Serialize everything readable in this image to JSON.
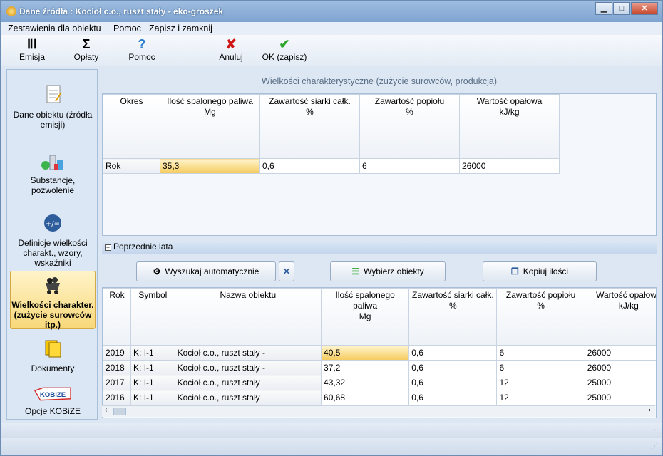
{
  "window": {
    "title": "Dane źródła : Kocioł c.o., ruszt stały - eko-groszek"
  },
  "menu": [
    "Zestawienia dla obiektu",
    "Pomoc",
    "Zapisz i zamknij"
  ],
  "toolbar": {
    "emisja": "Emisja",
    "oplaty": "Opłaty",
    "pomoc": "Pomoc",
    "anuluj": "Anuluj",
    "ok": "OK (zapisz)"
  },
  "sidebar": {
    "items": [
      {
        "label": "Dane obiektu (źródła emisji)"
      },
      {
        "label": "Substancje, pozwolenie"
      },
      {
        "label": "Definicje wielkości charakt., wzory, wskaźniki"
      },
      {
        "label": "Wielkości charakter. (zużycie surowców itp.)"
      },
      {
        "label": "Dokumenty"
      },
      {
        "label": "Opcje KOBiZE"
      }
    ]
  },
  "main": {
    "title": "Wielkości charakterystyczne (zużycie surowców, produkcja)",
    "top_grid": {
      "headers": [
        {
          "name": "Okres",
          "unit": ""
        },
        {
          "name": "Ilość spalonego paliwa",
          "unit": "Mg"
        },
        {
          "name": "Zawartość siarki całk.",
          "unit": "%"
        },
        {
          "name": "Zawartość popiołu",
          "unit": "%"
        },
        {
          "name": "Wartość opałowa",
          "unit": "kJ/kg"
        }
      ],
      "row": [
        "Rok",
        "35,3",
        "0,6",
        "6",
        "26000"
      ]
    },
    "section": "Poprzednie  lata",
    "buttons": {
      "search": "Wyszukaj automatycznie",
      "choose": "Wybierz obiekty",
      "copy": "Kopiuj ilości"
    },
    "bottom_grid": {
      "headers": [
        {
          "name": "Rok",
          "unit": ""
        },
        {
          "name": "Symbol",
          "unit": ""
        },
        {
          "name": "Nazwa obiektu",
          "unit": ""
        },
        {
          "name": "Ilość spalonego paliwa",
          "unit": "Mg"
        },
        {
          "name": "Zawartość siarki całk.",
          "unit": "%"
        },
        {
          "name": "Zawartość popiołu",
          "unit": "%"
        },
        {
          "name": "Wartość opałowa",
          "unit": "kJ/kg"
        }
      ],
      "rows": [
        [
          "2019",
          "K: I-1",
          "Kocioł c.o., ruszt stały -",
          "40,5",
          "0,6",
          "6",
          "26000"
        ],
        [
          "2018",
          "K: I-1",
          "Kocioł c.o., ruszt stały -",
          "37,2",
          "0,6",
          "6",
          "26000"
        ],
        [
          "2017",
          "K: I-1",
          "Kocioł c.o., ruszt stały",
          "43,32",
          "0,6",
          "12",
          "25000"
        ],
        [
          "2016",
          "K: I-1",
          "Kocioł c.o., ruszt stały",
          "60,68",
          "0,6",
          "12",
          "25000"
        ]
      ]
    }
  }
}
